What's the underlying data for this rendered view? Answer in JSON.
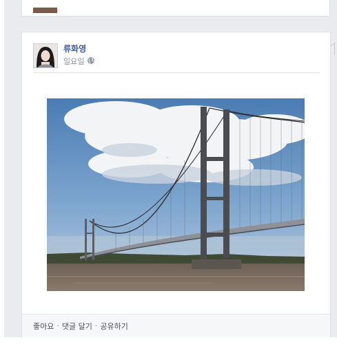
{
  "post": {
    "author": "류화영",
    "timestamp": "일요일",
    "privacy_icon": "globe-icon"
  },
  "actions": {
    "like": "좋아요",
    "comment": "댓글 달기",
    "share": "공유하기",
    "separator": "·"
  },
  "colors": {
    "link_blue": "#3b5998",
    "feed_background": "#e9ebee",
    "meta_gray": "#90949c"
  }
}
